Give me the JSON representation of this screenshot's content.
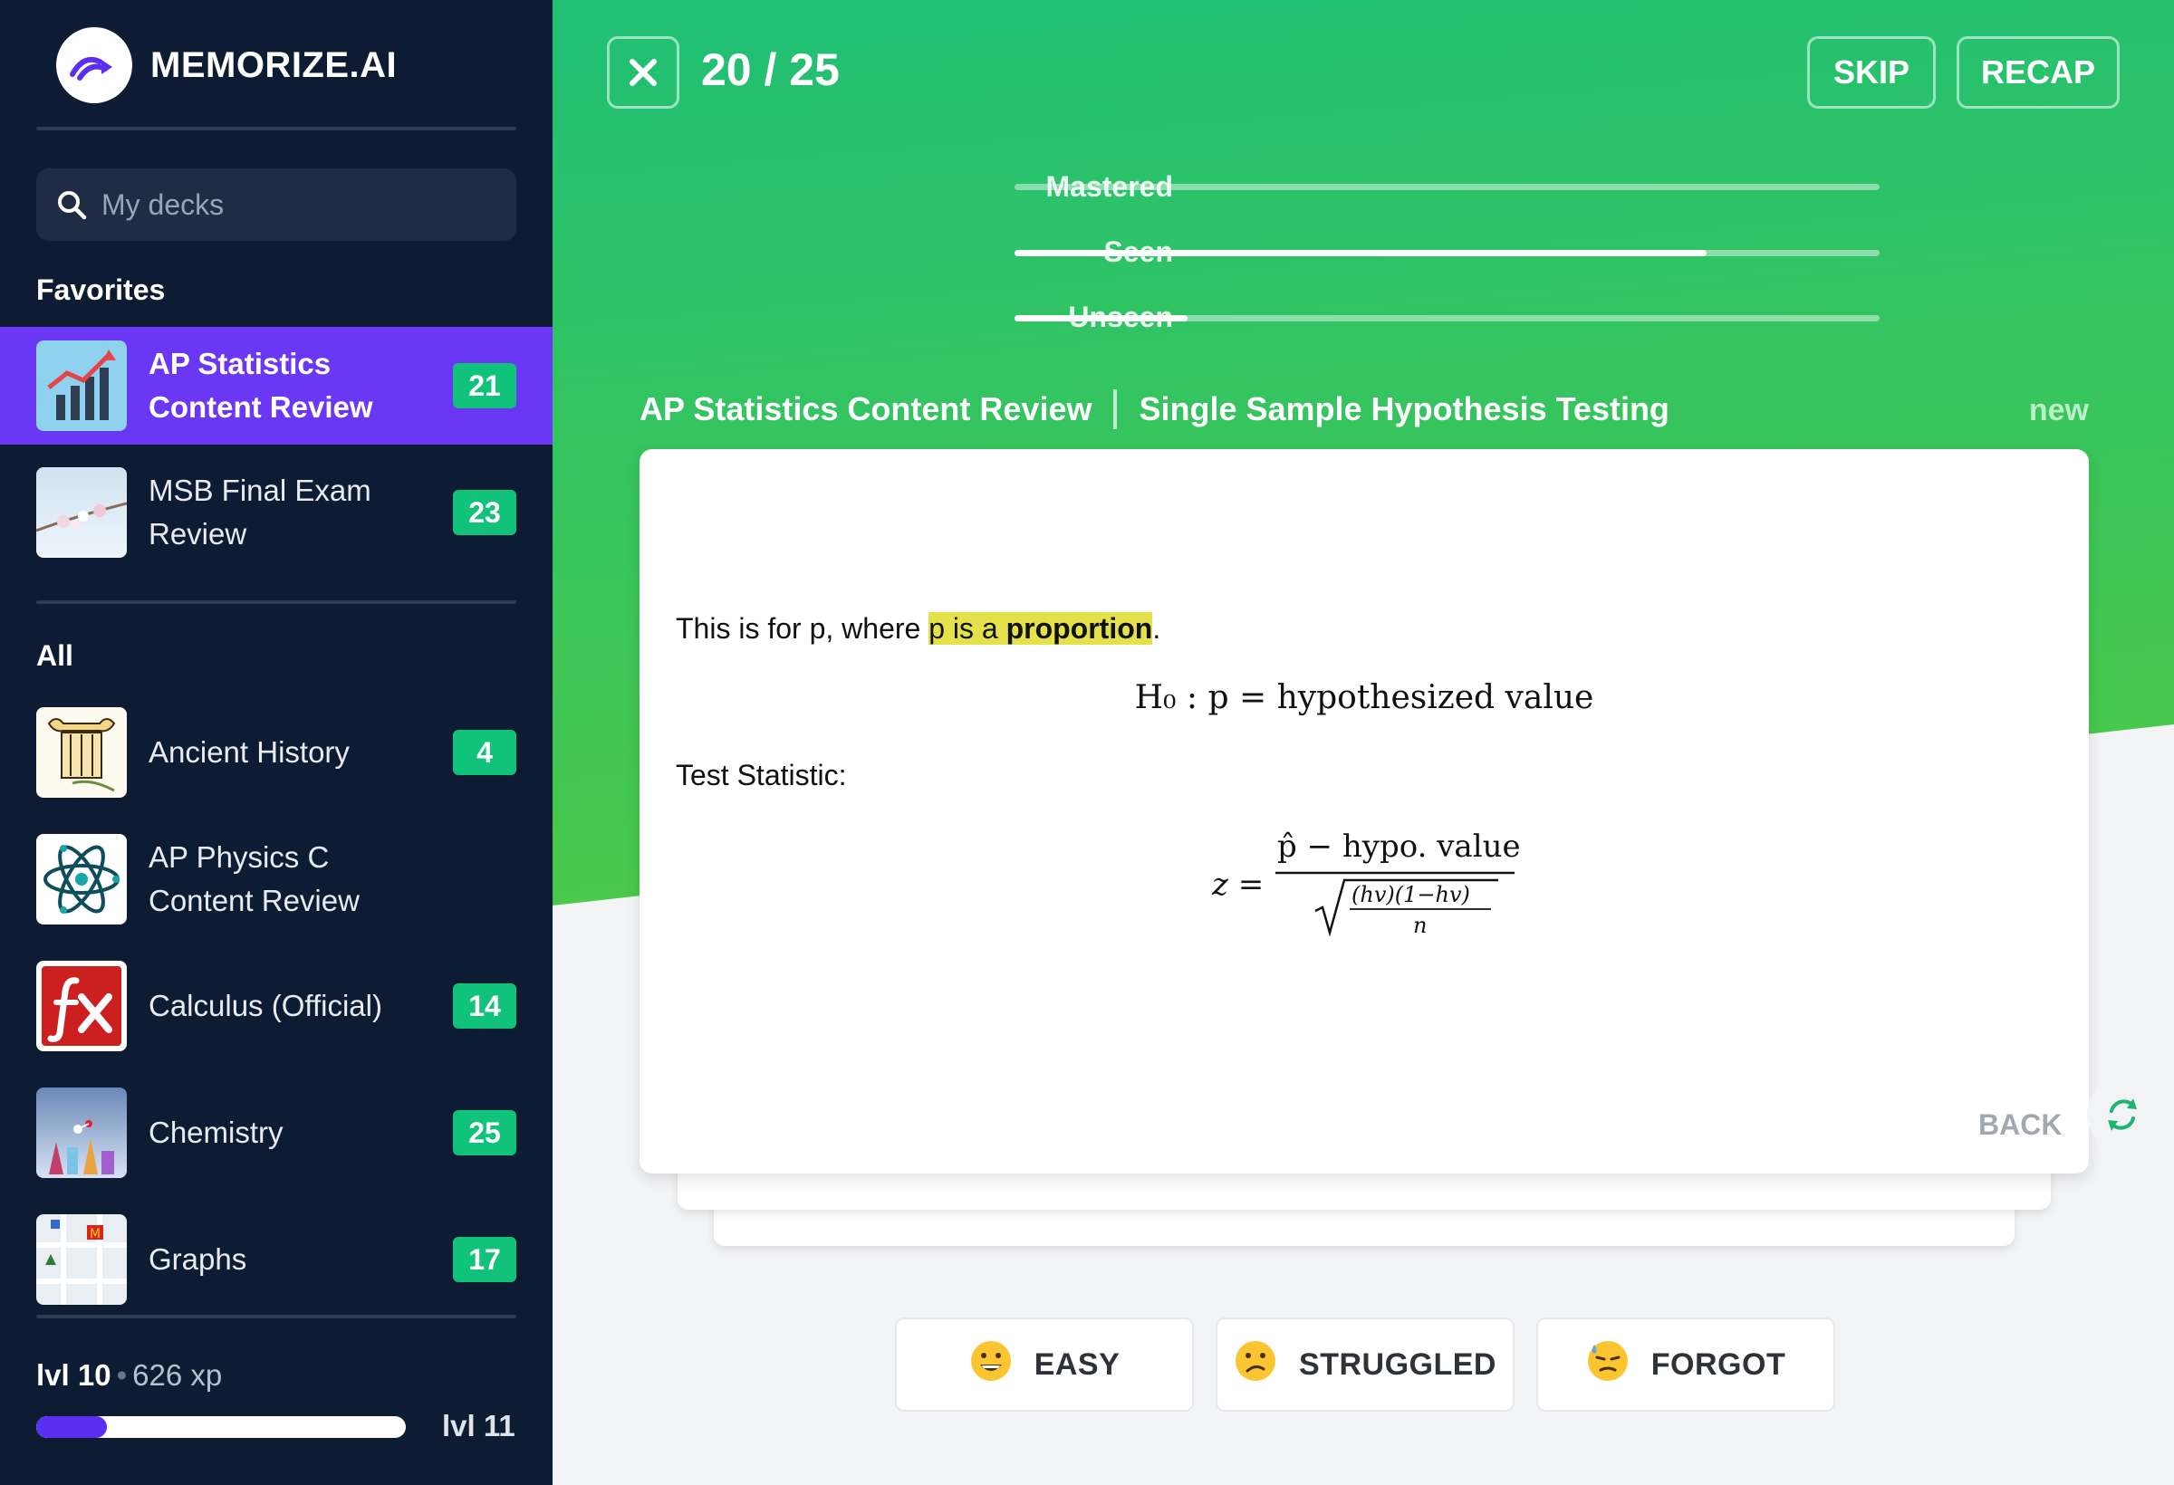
{
  "app": {
    "name": "MEMORIZE.AI"
  },
  "sidebar": {
    "search_placeholder": "My decks",
    "favorites_label": "Favorites",
    "all_label": "All",
    "favorites": [
      {
        "name": "AP Statistics Content Review",
        "count": "21",
        "active": true
      },
      {
        "name": "MSB Final Exam Review",
        "count": "23",
        "active": false
      }
    ],
    "all": [
      {
        "name": "Ancient History",
        "count": "4"
      },
      {
        "name": "AP Physics C Content Review",
        "count": ""
      },
      {
        "name": "Calculus (Official)",
        "count": "14"
      },
      {
        "name": "Chemistry",
        "count": "25"
      },
      {
        "name": "Graphs",
        "count": "17"
      }
    ],
    "level": {
      "current": "lvl 10",
      "xp": "626 xp",
      "next": "lvl 11",
      "progress": 0.19
    }
  },
  "session": {
    "counter": "20 / 25",
    "skip_label": "SKIP",
    "recap_label": "RECAP",
    "progress": [
      {
        "label": "Mastered",
        "value": 0.0
      },
      {
        "label": "Seen",
        "value": 0.8
      },
      {
        "label": "Unseen",
        "value": 0.2
      }
    ]
  },
  "card": {
    "deck": "AP Statistics Content Review",
    "topic": "Single Sample Hypothesis Testing",
    "status": "new",
    "line1_pre": "This is for p, where ",
    "line1_hl": "p is a ",
    "line1_bold": "proportion",
    "line1_post": ".",
    "math_h0": "H₀ : p = hypothesized value",
    "line2": "Test Statistic:",
    "formula": {
      "lhs": "z =",
      "numerator": "p̂ − hypo. value",
      "den_num": "(hv)(1−hv)",
      "den_den": "n"
    },
    "back_label": "BACK"
  },
  "ratings": [
    {
      "label": "EASY",
      "emoji": "😀"
    },
    {
      "label": "STRUGGLED",
      "emoji": "😕"
    },
    {
      "label": "FORGOT",
      "emoji": "😓"
    }
  ],
  "colors": {
    "sidebar": "#0e1c33",
    "active_deck": "#6a38f5",
    "badge": "#10c27a",
    "green_top": "#1fbf75",
    "green_bottom": "#43c94f"
  }
}
